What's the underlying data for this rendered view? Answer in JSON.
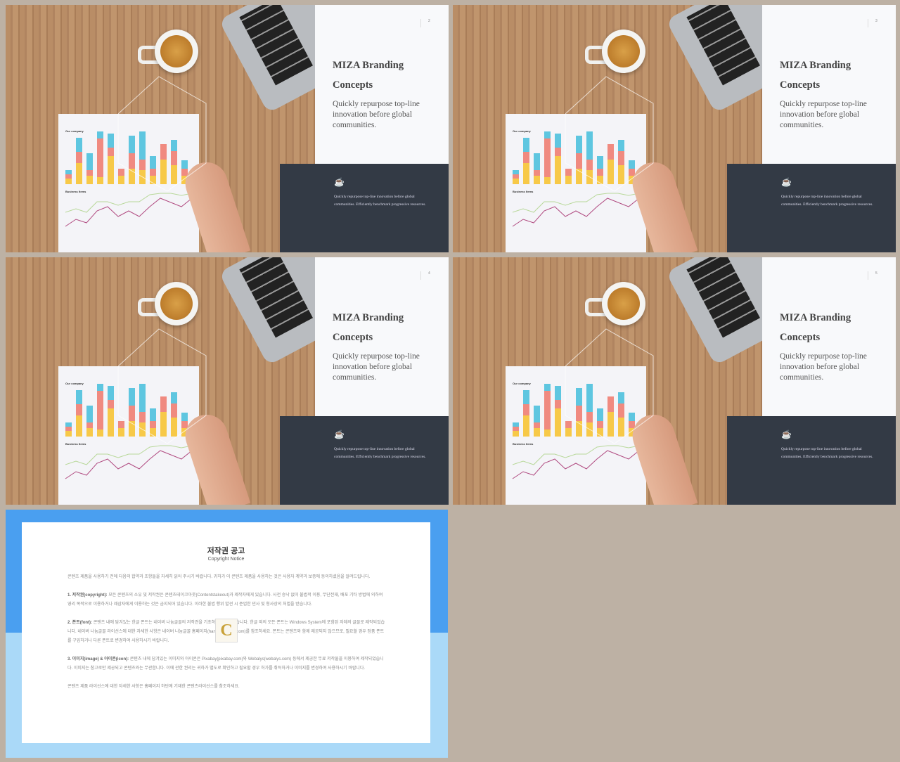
{
  "slides": [
    {
      "page": "2",
      "title": "MIZA Branding Concepts",
      "subtitle": "Quickly repurpose top-line innovation before global communities.",
      "dark_text": "Quickly repurpose top-line innovation before global communities. Efficiently benchmark progressive resources.",
      "photo_chart_title": "Our company",
      "photo_chart_title2": "Business Items",
      "icon": "coffee-cup-icon"
    },
    {
      "page": "3",
      "title": "MIZA Branding Concepts",
      "subtitle": "Quickly repurpose top-line innovation before global communities.",
      "dark_text": "Quickly repurpose top-line innovation before global communities. Efficiently benchmark progressive resources.",
      "photo_chart_title": "Our company",
      "photo_chart_title2": "Business Items",
      "icon": "coffee-cup-icon"
    },
    {
      "page": "4",
      "title": "MIZA Branding Concepts",
      "subtitle": "Quickly repurpose top-line innovation before global communities.",
      "dark_text": "Quickly repurpose top-line innovation before global communities. Efficiently benchmark progressive resources.",
      "photo_chart_title": "Our company",
      "photo_chart_title2": "Business Items",
      "icon": "coffee-cup-icon"
    },
    {
      "page": "5",
      "title": "MIZA Branding Concepts",
      "subtitle": "Quickly repurpose top-line innovation before global communities.",
      "dark_text": "Quickly repurpose top-line innovation before global communities. Efficiently benchmark progressive resources.",
      "photo_chart_title": "Our company",
      "photo_chart_title2": "Business Items",
      "icon": "coffee-cup-icon"
    }
  ],
  "copyright": {
    "title": "저작권 공고",
    "subtitle": "Copyright Notice",
    "intro": "콘텐츠 제품을 사용하기 전에 다음의 합약과 조항들을 자세히 읽어 주시기 바랍니다. 귀하가 이 콘텐츠 제품을 사용하는 것은 사용자 계약과 보증에 동의하셨음을 알려드립니다.",
    "s1_head": "1. 저작권(copyright):",
    "s1": " 모든 콘텐츠의 소유 및 저작권은 콘텐츠테이크아웃(Contentstakeout)과 제작자에게 있습니다. 사전 승낙 없이 불법적 이용, 무단전재, 배포 기타 방법에 의하여 영리 목적으로 이용하거나 제삼자에게 이용하는 것은 금지되어 있습니다. 이러한 불법 행위 발견 시 준엄한 민사 및 형사상의 처벌을 받습니다.",
    "s2_head": "2. 폰트(font):",
    "s2": " 콘텐츠 내에 담겨있는 한글 폰트는 네이버 나눔글꼴의 저작권을 기초하여 제작되었습니다. 한글 외의 모든 폰트는 Windows System에 포함된 자체의 글꼴로 제작되었습니다. 네이버 나눔글꼴 라이선스에 대한 자세한 사항은 네이버 나눔글꼴 홈페이지(hangeul.naver.com)를 참조하세요. 폰트는 콘텐츠와 함께 제공되지 않으므로, 필요할 경우 정품 폰트를 구입하거나 다른 폰트로 변경하여 사용하시기 바랍니다.",
    "s3_head": "3. 이미지(image) & 아이콘(icon):",
    "s3": " 콘텐츠 내에 담겨있는 이미지와 아이콘은 Pixabay(pixabay.com)와 Webalys(webalys.com) 등에서 제공한 무료 저작물을 이용하여 제작되었습니다. 이미지는 참고로만 제공되고 콘텐츠와는 무관합니다. 이에 관한 권리는 귀하가 별도로 확인하고 필요할 경우 허가를 취득하거나 이미지를 변경하여 사용하시기 바랍니다.",
    "outro": "콘텐츠 제품 라이선스에 대한 자세한 사항은 홈페이지 하단에 기재한 콘텐츠라이선스를 참조하세요.",
    "logo": "C"
  },
  "colors": {
    "background": "#bdb1a4",
    "dark_panel": "#333a45",
    "copyright_blue": "#4a9ff0",
    "copyright_light_blue": "#aad9f8"
  }
}
